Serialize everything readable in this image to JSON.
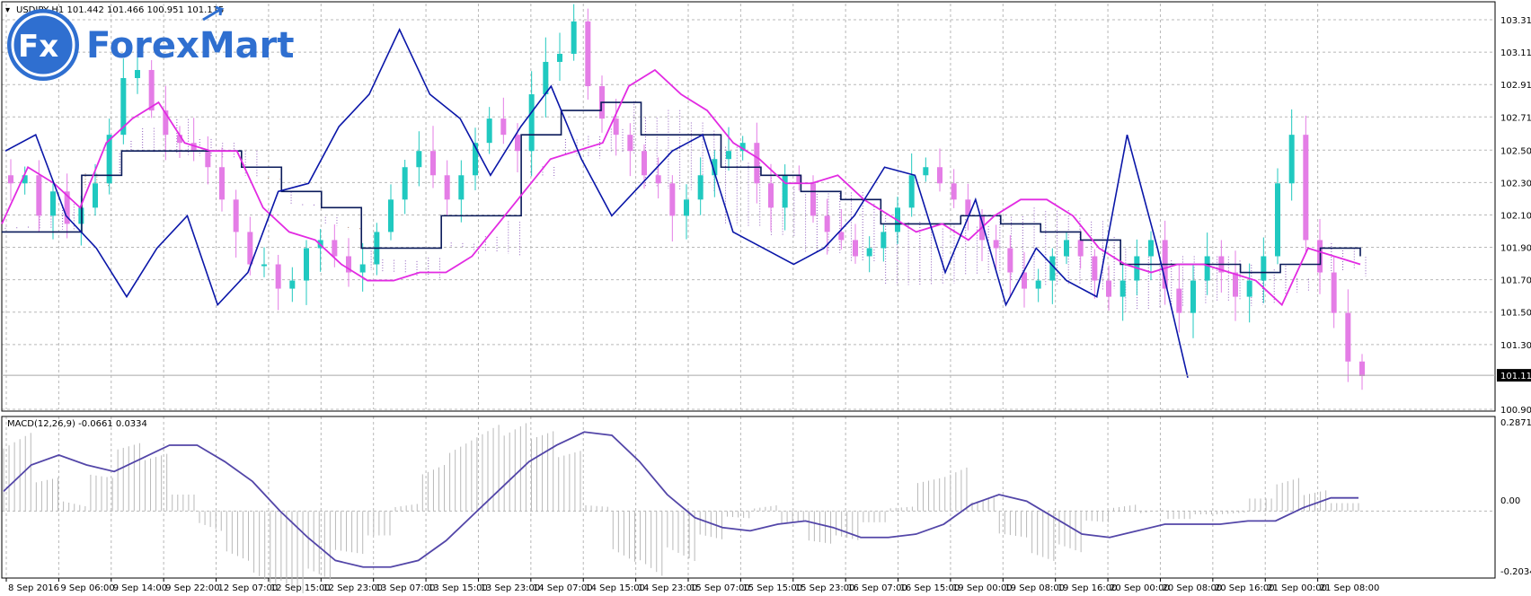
{
  "header": {
    "symbol_info": "USDJPY,H1  101.442 101.466 100.951 101.115",
    "logo_mark": "Fx",
    "logo_text": "ForexMart"
  },
  "macd": {
    "label": "MACD(12,26,9) -0.0661 0.0334",
    "axis_top": "0.2871",
    "axis_zero": "0.00",
    "axis_bottom": "-0.2034"
  },
  "colors": {
    "bull": "#20c9c0",
    "bear": "#e47de6",
    "kijun": "#0a1a5a",
    "tenkan": "#e22be2",
    "chikou": "#0a16a8",
    "cloud_bull": "#7b3fb0",
    "cloud_bear": "#9b6450",
    "grid": "#b8b8b8"
  },
  "chart_data": [
    {
      "type": "candlestick",
      "symbol": "USDJPY",
      "timeframe": "H1",
      "ylim": [
        100.905,
        103.41
      ],
      "y_ticks": [
        "103.310",
        "103.110",
        "102.910",
        "102.710",
        "102.505",
        "102.305",
        "102.105",
        "101.905",
        "101.705",
        "101.505",
        "101.305",
        "100.905"
      ],
      "last_price_label": "101.115",
      "last_price": 101.115,
      "x_tick_labels": [
        "8 Sep 2016",
        "9 Sep 06:00",
        "9 Sep 14:00",
        "9 Sep 22:00",
        "12 Sep 07:00",
        "12 Sep 15:00",
        "12 Sep 23:00",
        "13 Sep 07:00",
        "13 Sep 15:00",
        "13 Sep 23:00",
        "14 Sep 07:00",
        "14 Sep 15:00",
        "14 Sep 23:00",
        "15 Sep 07:00",
        "15 Sep 15:00",
        "15 Sep 23:00",
        "16 Sep 07:00",
        "16 Sep 15:00",
        "19 Sep 00:00",
        "19 Sep 08:00",
        "19 Sep 16:00",
        "20 Sep 00:00",
        "20 Sep 08:00",
        "20 Sep 16:00",
        "21 Sep 00:00",
        "21 Sep 08:00"
      ],
      "close_path": [
        102.3,
        102.35,
        102.1,
        102.25,
        102.05,
        102.15,
        102.3,
        102.6,
        102.95,
        103.0,
        102.75,
        102.6,
        102.55,
        102.5,
        102.4,
        102.2,
        102.0,
        101.8,
        101.8,
        101.65,
        101.7,
        101.9,
        101.95,
        101.85,
        101.75,
        101.8,
        102.0,
        102.2,
        102.4,
        102.5,
        102.35,
        102.2,
        102.35,
        102.55,
        102.7,
        102.6,
        102.5,
        102.85,
        103.05,
        103.1,
        103.3,
        102.9,
        102.7,
        102.6,
        102.5,
        102.35,
        102.3,
        102.1,
        102.2,
        102.35,
        102.45,
        102.5,
        102.55,
        102.3,
        102.15,
        102.35,
        102.3,
        102.1,
        102.0,
        101.95,
        101.85,
        101.9,
        102.0,
        102.15,
        102.35,
        102.4,
        102.3,
        102.2,
        102.1,
        101.95,
        101.9,
        101.75,
        101.65,
        101.7,
        101.85,
        101.95,
        101.85,
        101.7,
        101.6,
        101.7,
        101.85,
        101.95,
        101.65,
        101.5,
        101.7,
        101.85,
        101.75,
        101.6,
        101.7,
        101.85,
        102.3,
        102.6,
        101.95,
        101.75,
        101.5,
        101.2,
        101.11
      ],
      "ichimoku": {
        "tenkan_sen": [
          102.05,
          102.4,
          102.3,
          102.15,
          102.55,
          102.7,
          102.8,
          102.55,
          102.5,
          102.5,
          102.15,
          102.0,
          101.95,
          101.8,
          101.7,
          101.7,
          101.75,
          101.75,
          101.85,
          102.05,
          102.25,
          102.45,
          102.5,
          102.55,
          102.9,
          103.0,
          102.85,
          102.75,
          102.55,
          102.45,
          102.3,
          102.3,
          102.35,
          102.2,
          102.1,
          102.0,
          102.05,
          101.95,
          102.1,
          102.2,
          102.2,
          102.1,
          101.9,
          101.8,
          101.75,
          101.8,
          101.8,
          101.75,
          101.7,
          101.55,
          101.9,
          101.85,
          101.8
        ],
        "kijun_sen": [
          102.0,
          102.0,
          102.35,
          102.5,
          102.5,
          102.5,
          102.4,
          102.25,
          102.15,
          101.9,
          101.9,
          102.1,
          102.1,
          102.6,
          102.75,
          102.8,
          102.6,
          102.6,
          102.4,
          102.35,
          102.25,
          102.2,
          102.05,
          102.05,
          102.1,
          102.05,
          102.0,
          101.95,
          101.8,
          101.8,
          101.8,
          101.75,
          101.8,
          101.9,
          101.85
        ],
        "chikou_span": [
          102.5,
          102.6,
          102.1,
          101.9,
          101.6,
          101.9,
          102.1,
          101.55,
          101.75,
          102.25,
          102.3,
          102.65,
          102.85,
          103.25,
          102.85,
          102.7,
          102.35,
          102.65,
          102.9,
          102.45,
          102.1,
          102.3,
          102.5,
          102.6,
          102.0,
          101.9,
          101.8,
          101.9,
          102.1,
          102.4,
          102.35,
          101.75,
          102.2,
          101.55,
          101.9,
          101.7,
          101.6,
          102.6,
          101.9,
          101.1
        ]
      }
    },
    {
      "type": "histogram+line",
      "name": "MACD(12,26,9)",
      "ylim": [
        -0.2034,
        0.2871
      ],
      "main": -0.0661,
      "signal": 0.0334,
      "signal_path": [
        0.06,
        0.14,
        0.17,
        0.14,
        0.12,
        0.16,
        0.2,
        0.2,
        0.15,
        0.09,
        0.0,
        -0.08,
        -0.15,
        -0.17,
        -0.17,
        -0.15,
        -0.09,
        -0.01,
        0.07,
        0.15,
        0.2,
        0.24,
        0.23,
        0.15,
        0.05,
        -0.02,
        -0.05,
        -0.06,
        -0.04,
        -0.03,
        -0.05,
        -0.08,
        -0.08,
        -0.07,
        -0.04,
        0.02,
        0.05,
        0.03,
        -0.02,
        -0.07,
        -0.08,
        -0.06,
        -0.04,
        -0.04,
        -0.04,
        -0.03,
        -0.03,
        0.01,
        0.04,
        0.04
      ]
    }
  ]
}
